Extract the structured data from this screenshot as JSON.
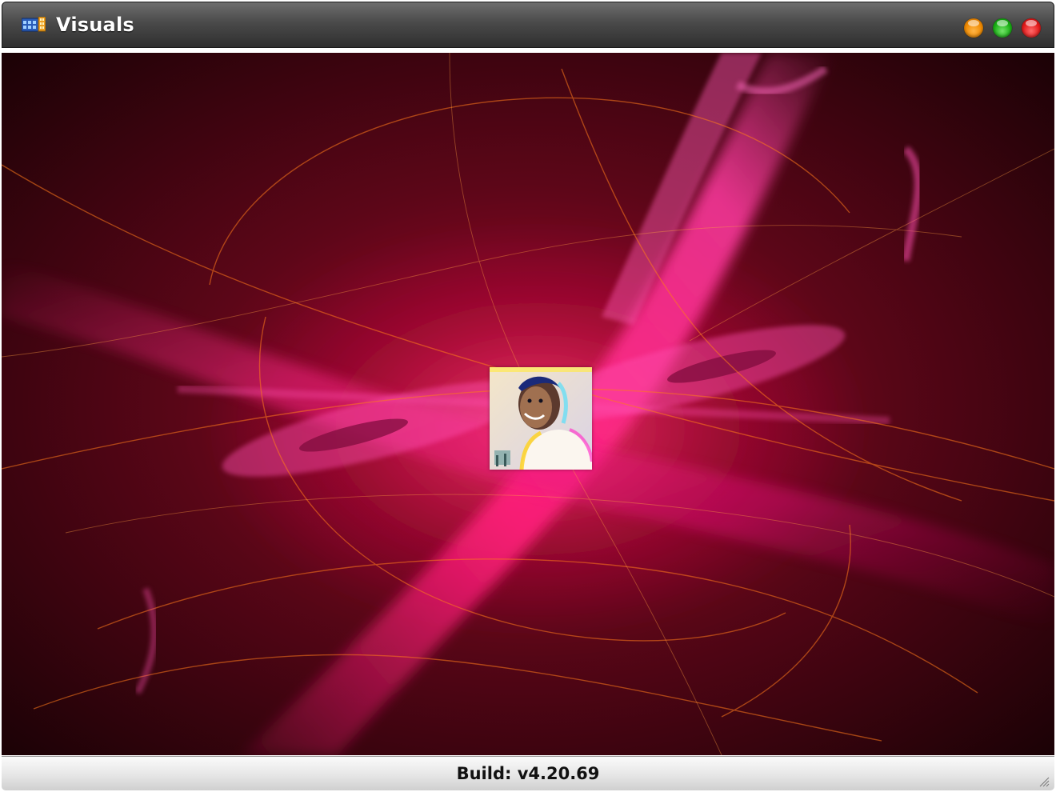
{
  "window": {
    "title": "Visuals",
    "app_icon": "film-strip-icon",
    "controls": {
      "minimize_icon": "minimize-dot-icon",
      "maximize_icon": "maximize-dot-icon",
      "close_icon": "close-dot-icon",
      "colors": {
        "minimize": "#f08a00",
        "maximize": "#19b014",
        "close": "#e31a1a"
      }
    }
  },
  "visualizer": {
    "background_icon": "abstract-light-swirl-image",
    "accent_colors": [
      "#ff1e7a",
      "#d4006a",
      "#ff7a1a",
      "#3a0410"
    ],
    "album_art_icon": "album-art-portrait-image"
  },
  "statusbar": {
    "build_text": "Build: v4.20.69",
    "resize_icon": "resize-grip-icon"
  }
}
